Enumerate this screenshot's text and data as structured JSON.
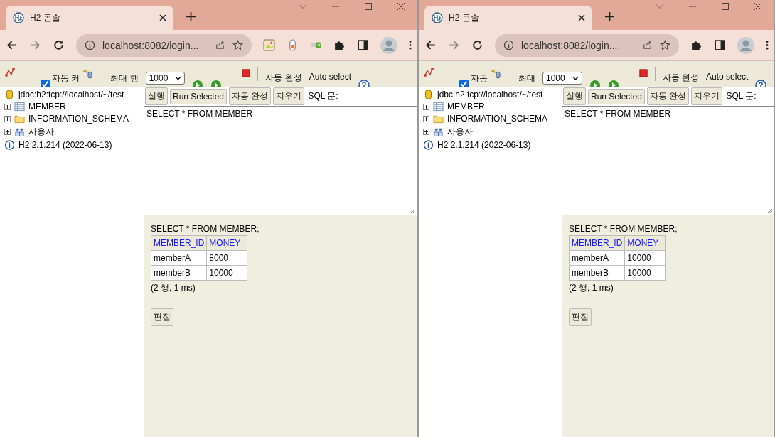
{
  "windows": [
    {
      "tab_title": "H2 콘솔",
      "url": "localhost:8082/login...",
      "show_extensions": true,
      "toolbar": {
        "auto_commit_label": "자동 커",
        "auto_commit_checked": true,
        "max_rows_label": "최대 행",
        "max_rows_value": "1000",
        "autocomplete_label": "자동 완성",
        "auto_select_label": "Auto select"
      },
      "tree": {
        "connection": "jdbc:h2:tcp://localhost/~/test",
        "items": [
          {
            "label": "MEMBER",
            "kind": "table"
          },
          {
            "label": "INFORMATION_SCHEMA",
            "kind": "folder"
          },
          {
            "label": "사용자",
            "kind": "users"
          }
        ],
        "version": "H2 2.1.214 (2022-06-13)"
      },
      "sql_buttons": [
        "실행",
        "Run Selected",
        "자동 완성",
        "지우기"
      ],
      "sql_label": "SQL 문:",
      "sql_text": "SELECT * FROM MEMBER",
      "result": {
        "statement": "SELECT * FROM MEMBER;",
        "columns": [
          "MEMBER_ID",
          "MONEY"
        ],
        "rows": [
          [
            "memberA",
            "8000"
          ],
          [
            "memberB",
            "10000"
          ]
        ],
        "summary": "(2 행, 1 ms)",
        "edit_button": "편집"
      }
    },
    {
      "tab_title": "H2 콘솔",
      "url": "localhost:8082/login....",
      "show_extensions": false,
      "toolbar": {
        "auto_commit_label": "자동",
        "auto_commit_checked": true,
        "max_rows_label": "최대",
        "max_rows_value": "1000",
        "autocomplete_label": "자동 완성",
        "auto_select_label": "Auto select"
      },
      "tree": {
        "connection": "jdbc:h2:tcp://localhost/~/test",
        "items": [
          {
            "label": "MEMBER",
            "kind": "table"
          },
          {
            "label": "INFORMATION_SCHEMA",
            "kind": "folder"
          },
          {
            "label": "사용자",
            "kind": "users"
          }
        ],
        "version": "H2 2.1.214 (2022-06-13)"
      },
      "sql_buttons": [
        "실행",
        "Run Selected",
        "자동 완성",
        "지우기"
      ],
      "sql_label": "SQL 문:",
      "sql_text": "SELECT * FROM MEMBER",
      "result": {
        "statement": "SELECT * FROM MEMBER;",
        "columns": [
          "MEMBER_ID",
          "MONEY"
        ],
        "rows": [
          [
            "memberA",
            "10000"
          ],
          [
            "memberB",
            "10000"
          ]
        ],
        "summary": "(2 행, 1 ms)",
        "edit_button": "편집"
      }
    }
  ]
}
